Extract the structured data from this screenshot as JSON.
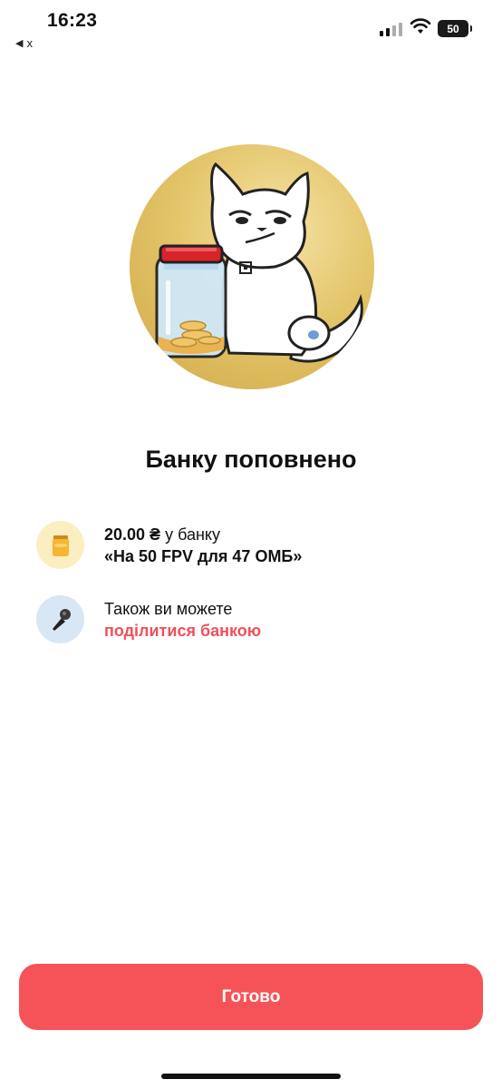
{
  "status_bar": {
    "time": "16:23",
    "back_app_label": "x",
    "battery_level": "50",
    "icons": [
      "signal-icon",
      "wifi-icon",
      "battery-icon"
    ]
  },
  "hero": {
    "illustration": "cat-with-coin-jar",
    "background_color": "#dcbb5c"
  },
  "title": "Банку поповнено",
  "rows": [
    {
      "icon": "honey-jar-icon",
      "amount": "20.00 ₴",
      "line1_suffix": " у банку",
      "line2": "«На 50 FPV для 47 ОМБ»"
    },
    {
      "icon": "microphone-icon",
      "line1": "Також ви можете",
      "link": "поділитися банкою"
    }
  ],
  "done_button": {
    "label": "Готово",
    "color": "#f65358"
  },
  "colors": {
    "accent": "#f0505a"
  }
}
